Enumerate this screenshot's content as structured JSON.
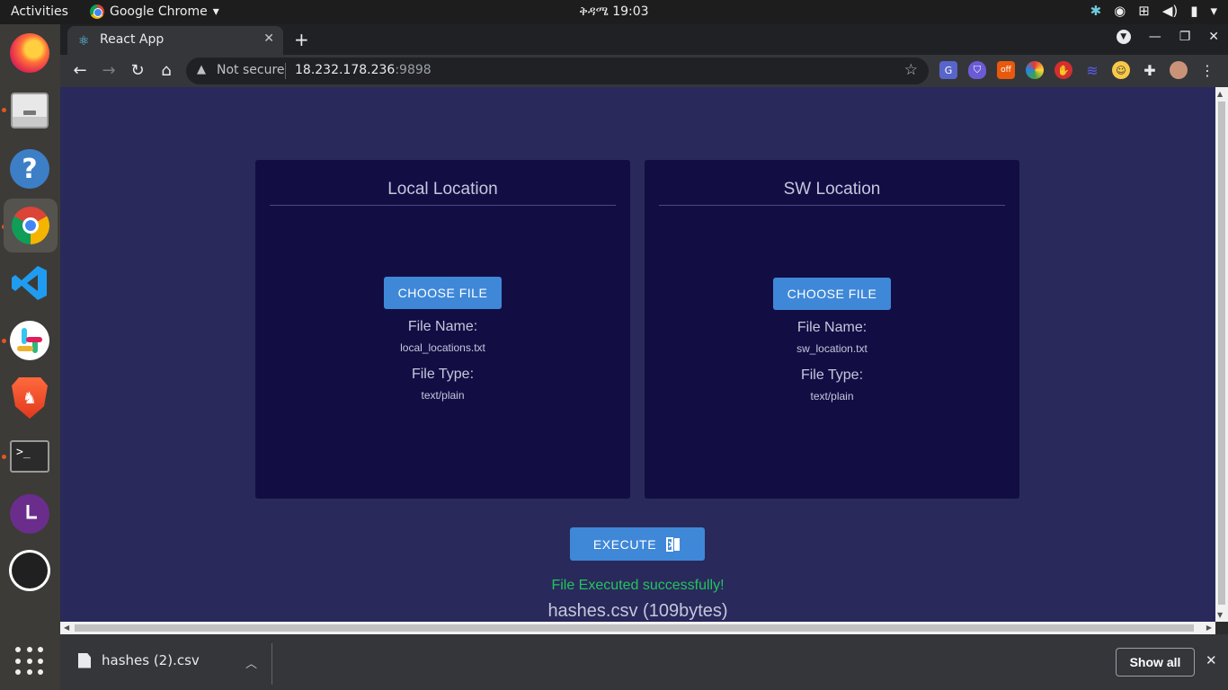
{
  "topbar": {
    "activities": "Activities",
    "app_name": "Google Chrome",
    "app_menu_caret": "▾",
    "clock": "ቅዳሜ 19:03",
    "tray_icons": [
      "slack-tray-icon",
      "obs-tray-icon",
      "network-icon",
      "volume-icon",
      "battery-icon",
      "power-menu-icon"
    ]
  },
  "dock": {
    "apps": [
      "firefox",
      "files",
      "help",
      "chrome",
      "vscode",
      "slack",
      "brave",
      "terminal",
      "timer",
      "obs"
    ],
    "active": "chrome"
  },
  "browser": {
    "tab_title": "React App",
    "tab_close": "✕",
    "new_tab": "+",
    "security_label": "Not secure",
    "url_host": "18.232.178.236",
    "url_port": ":9898"
  },
  "page": {
    "local_card": {
      "title": "Local Location",
      "button": "CHOOSE FILE",
      "file_name_label": "File Name:",
      "file_name": "local_locations.txt",
      "file_type_label": "File Type:",
      "file_type": "text/plain"
    },
    "sw_card": {
      "title": "SW Location",
      "button": "CHOOSE FILE",
      "file_name_label": "File Name:",
      "file_name": "sw_location.txt",
      "file_type_label": "File Type:",
      "file_type": "text/plain"
    },
    "execute_button": "EXECUTE",
    "status": "File Executed successfully!",
    "result_file": "hashes.csv (109bytes)"
  },
  "download_shelf": {
    "item": "hashes (2).csv",
    "show_all": "Show all",
    "close": "✕"
  },
  "colors": {
    "page_bg": "#29295b",
    "card_bg": "#120e44",
    "button_bg": "#3f88d8",
    "success": "#22c55e"
  }
}
